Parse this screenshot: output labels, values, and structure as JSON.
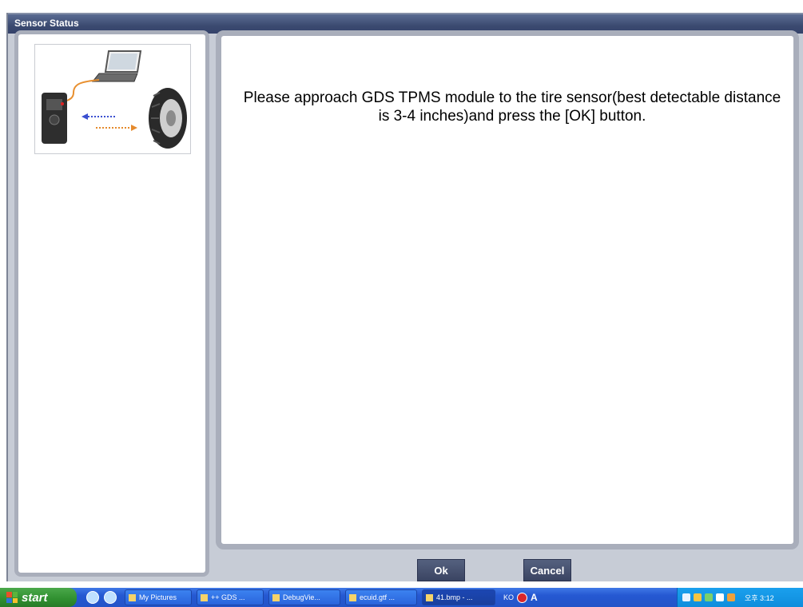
{
  "window": {
    "title": "Sensor Status"
  },
  "main": {
    "message": "Please approach GDS TPMS module to the tire sensor(best detectable distance is 3-4 inches)and press the [OK] button."
  },
  "buttons": {
    "ok": "Ok",
    "cancel": "Cancel"
  },
  "taskbar": {
    "start": "start",
    "tasks": [
      {
        "label": "My Pictures"
      },
      {
        "label": "++ GDS ..."
      },
      {
        "label": "DebugVie..."
      },
      {
        "label": "ecuid.gtf ..."
      },
      {
        "label": "41.bmp - ..."
      }
    ],
    "lang": "KO",
    "lang_mode": "A",
    "tray_text": "오후 3:12"
  },
  "colors": {
    "titlebar": "#3b4a70",
    "panel_border": "#a9aebb",
    "button": "#3a4462",
    "taskbar": "#2558d2"
  }
}
